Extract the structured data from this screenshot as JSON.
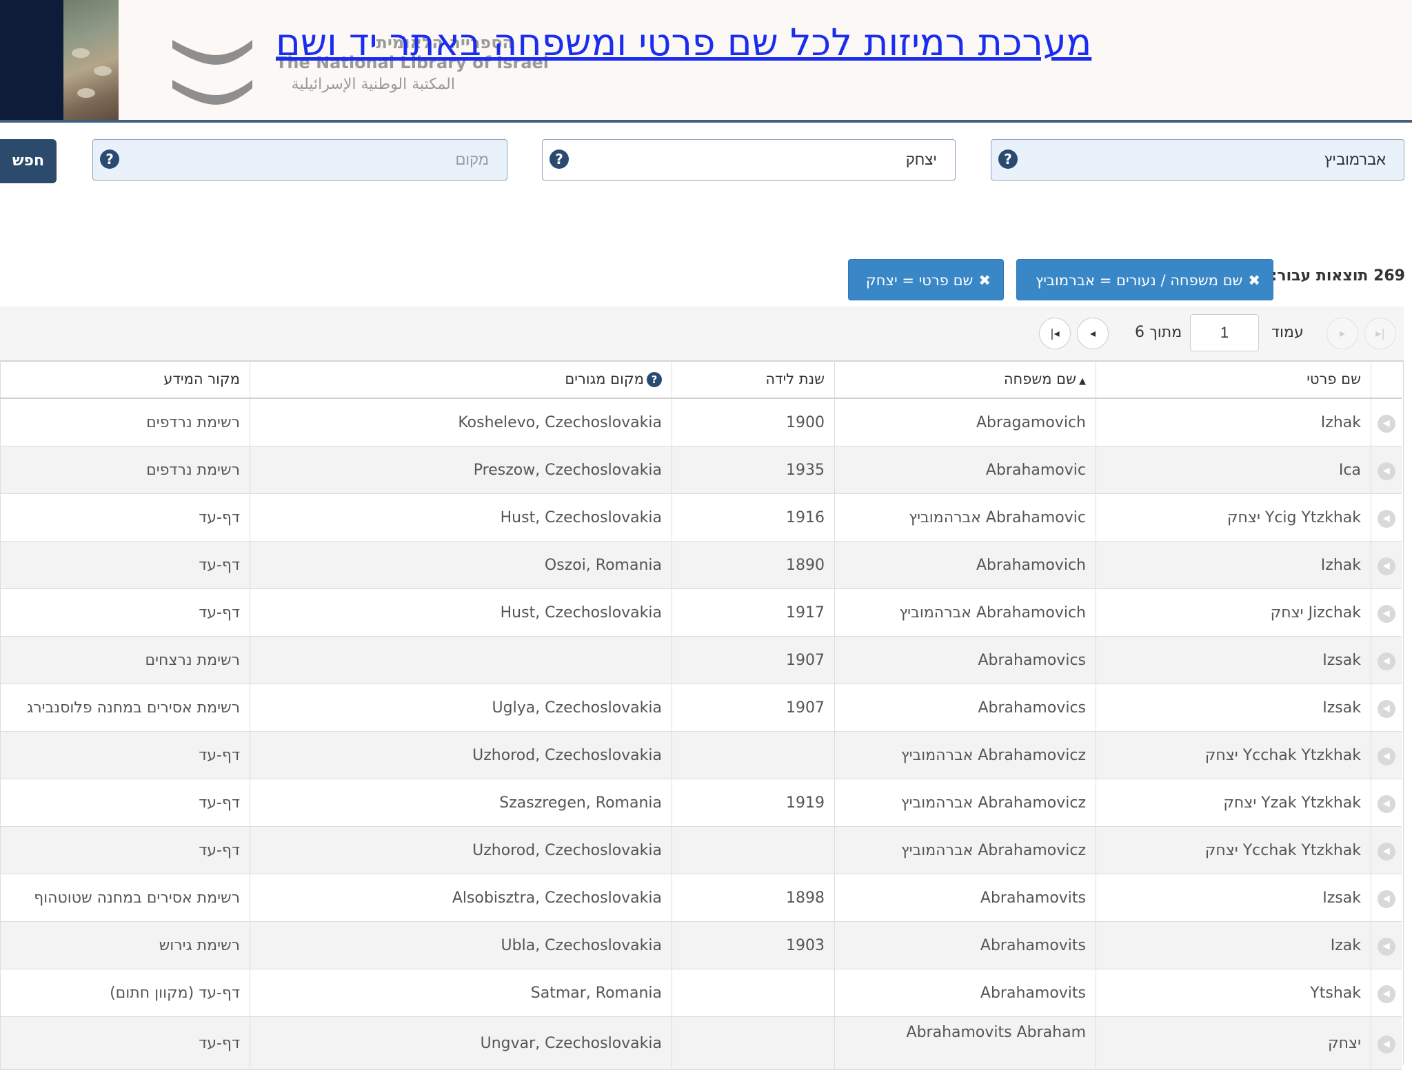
{
  "header": {
    "title": "מערכת רמיזות לכל שם פרטי ומשפחה באתר יד ושם",
    "logo_line1": "הספרייה הלאומית",
    "logo_line2": "The National Library of Israel",
    "logo_line3": "المكتبة الوطنية الإسرائيلية"
  },
  "search": {
    "last_name_value": "אברמוביץ",
    "first_name_value": "יצחק",
    "place_placeholder": "מקום",
    "help_glyph": "?",
    "submit_label": "חפש"
  },
  "filters": {
    "results_text": "269 תוצאות עבור:",
    "chips": [
      {
        "label": "שם משפחה / נעורים = אברמוביץ"
      },
      {
        "label": "שם פרטי = יצחק"
      }
    ],
    "remove_glyph": "✖"
  },
  "pager": {
    "page_label": "עמוד",
    "current_page": "1",
    "of_label": "מתוך 6"
  },
  "table": {
    "columns": [
      "שם פרטי",
      "שם משפחה",
      "שנת לידה",
      "מקום מגורים",
      "מקור המידע"
    ],
    "sorted_column": "שם משפחה",
    "rows": [
      {
        "first": "Izhak",
        "last": "Abragamovich",
        "year": "1900",
        "place": "Koshelevo, Czechoslovakia",
        "source": "רשימת נרדפים"
      },
      {
        "first": "Ica",
        "last": "Abrahamovic",
        "year": "1935",
        "place": "Preszow, Czechoslovakia",
        "source": "רשימת נרדפים"
      },
      {
        "first": "Ycig Ytzkhak יצחק",
        "last": "Abrahamovic אברהמוביץ",
        "year": "1916",
        "place": "Hust, Czechoslovakia",
        "source": "דף-עד"
      },
      {
        "first": "Izhak",
        "last": "Abrahamovich",
        "year": "1890",
        "place": "Oszoi, Romania",
        "source": "דף-עד"
      },
      {
        "first": "Jizchak יצחק",
        "last": "Abrahamovich אברהמוביץ",
        "year": "1917",
        "place": "Hust, Czechoslovakia",
        "source": "דף-עד"
      },
      {
        "first": "Izsak",
        "last": "Abrahamovics",
        "year": "1907",
        "place": "",
        "source": "רשימת נרצחים"
      },
      {
        "first": "Izsak",
        "last": "Abrahamovics",
        "year": "1907",
        "place": "Uglya, Czechoslovakia",
        "source": "רשימת אסירים במחנה פלוסנבירג"
      },
      {
        "first": "Ycchak Ytzkhak יצחק",
        "last": "Abrahamovicz אברהמוביץ",
        "year": "",
        "place": "Uzhorod, Czechoslovakia",
        "source": "דף-עד"
      },
      {
        "first": "Yzak Ytzkhak יצחק",
        "last": "Abrahamovicz אברהמוביץ",
        "year": "1919",
        "place": "Szaszregen, Romania",
        "source": "דף-עד"
      },
      {
        "first": "Ycchak Ytzkhak יצחק",
        "last": "Abrahamovicz אברהמוביץ",
        "year": "",
        "place": "Uzhorod, Czechoslovakia",
        "source": "דף-עד"
      },
      {
        "first": "Izsak",
        "last": "Abrahamovits",
        "year": "1898",
        "place": "Alsobisztra, Czechoslovakia",
        "source": "רשימת אסירים במחנה שטוטהוף"
      },
      {
        "first": "Izak",
        "last": "Abrahamovits",
        "year": "1903",
        "place": "Ubla, Czechoslovakia",
        "source": "רשימת גירוש"
      },
      {
        "first": "Ytshak",
        "last": "Abrahamovits",
        "year": "",
        "place": "Satmar, Romania",
        "source": "דף-עד (מקוון חתום)"
      },
      {
        "first": "יצחק",
        "last": "Abrahamovits Abraham",
        "year": "",
        "place": "Ungvar, Czechoslovakia",
        "source": "דף-עד"
      }
    ]
  },
  "colors": {
    "title_link": "#1a2cf0",
    "chip_blue": "#3a87c8",
    "search_button": "#2c4a6c",
    "header_rule": "#3f5f7d"
  }
}
